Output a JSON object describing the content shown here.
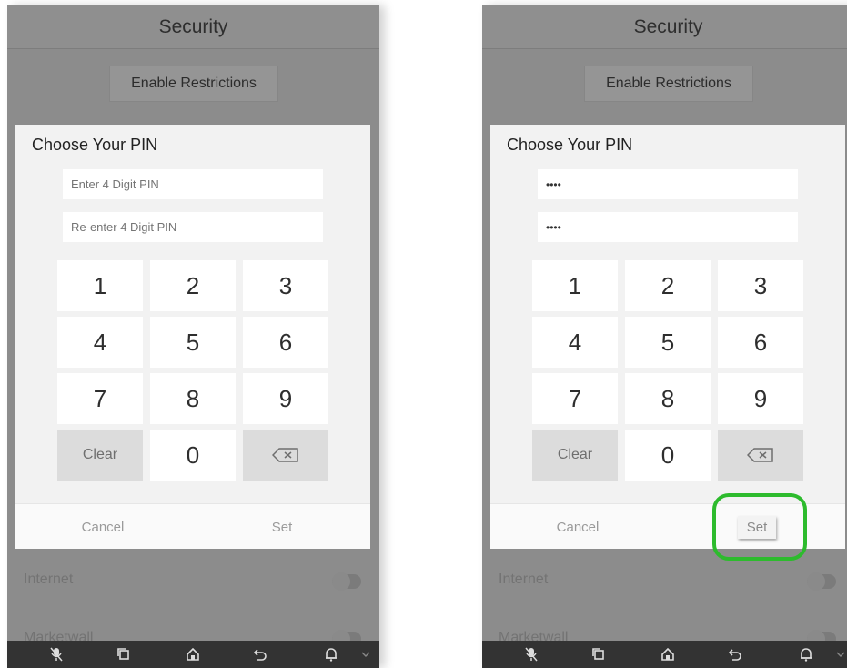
{
  "left_screen": {
    "title": "Security",
    "enable_restrictions_label": "Enable Restrictions",
    "background_settings": [
      "Internet",
      "Marketwall"
    ],
    "dialog": {
      "title": "Choose Your PIN",
      "pin_placeholder": "Enter 4 Digit PIN",
      "reenter_placeholder": "Re-enter 4 Digit PIN",
      "pin_value": "",
      "reenter_value": "",
      "keys": [
        "1",
        "2",
        "3",
        "4",
        "5",
        "6",
        "7",
        "8",
        "9"
      ],
      "clear_label": "Clear",
      "zero_label": "0",
      "cancel_label": "Cancel",
      "set_label": "Set"
    }
  },
  "right_screen": {
    "title": "Security",
    "enable_restrictions_label": "Enable Restrictions",
    "background_settings": [
      "Internet",
      "Marketwall"
    ],
    "dialog": {
      "title": "Choose Your PIN",
      "pin_value": "••••",
      "reenter_value": "••••",
      "keys": [
        "1",
        "2",
        "3",
        "4",
        "5",
        "6",
        "7",
        "8",
        "9"
      ],
      "clear_label": "Clear",
      "zero_label": "0",
      "cancel_label": "Cancel",
      "set_label": "Set"
    },
    "highlight_color": "#2dbb2d"
  },
  "navbar_icons": [
    "mic-icon",
    "recent-apps-icon",
    "home-icon",
    "back-icon",
    "notification-icon",
    "chevron-down-icon"
  ],
  "colors": {
    "overlay_gray": "#8c8c8c",
    "dialog_bg": "#f2f2f2",
    "key_bg": "#ffffff",
    "special_key_bg": "#dcdcdc",
    "navbar_bg": "#333333"
  }
}
